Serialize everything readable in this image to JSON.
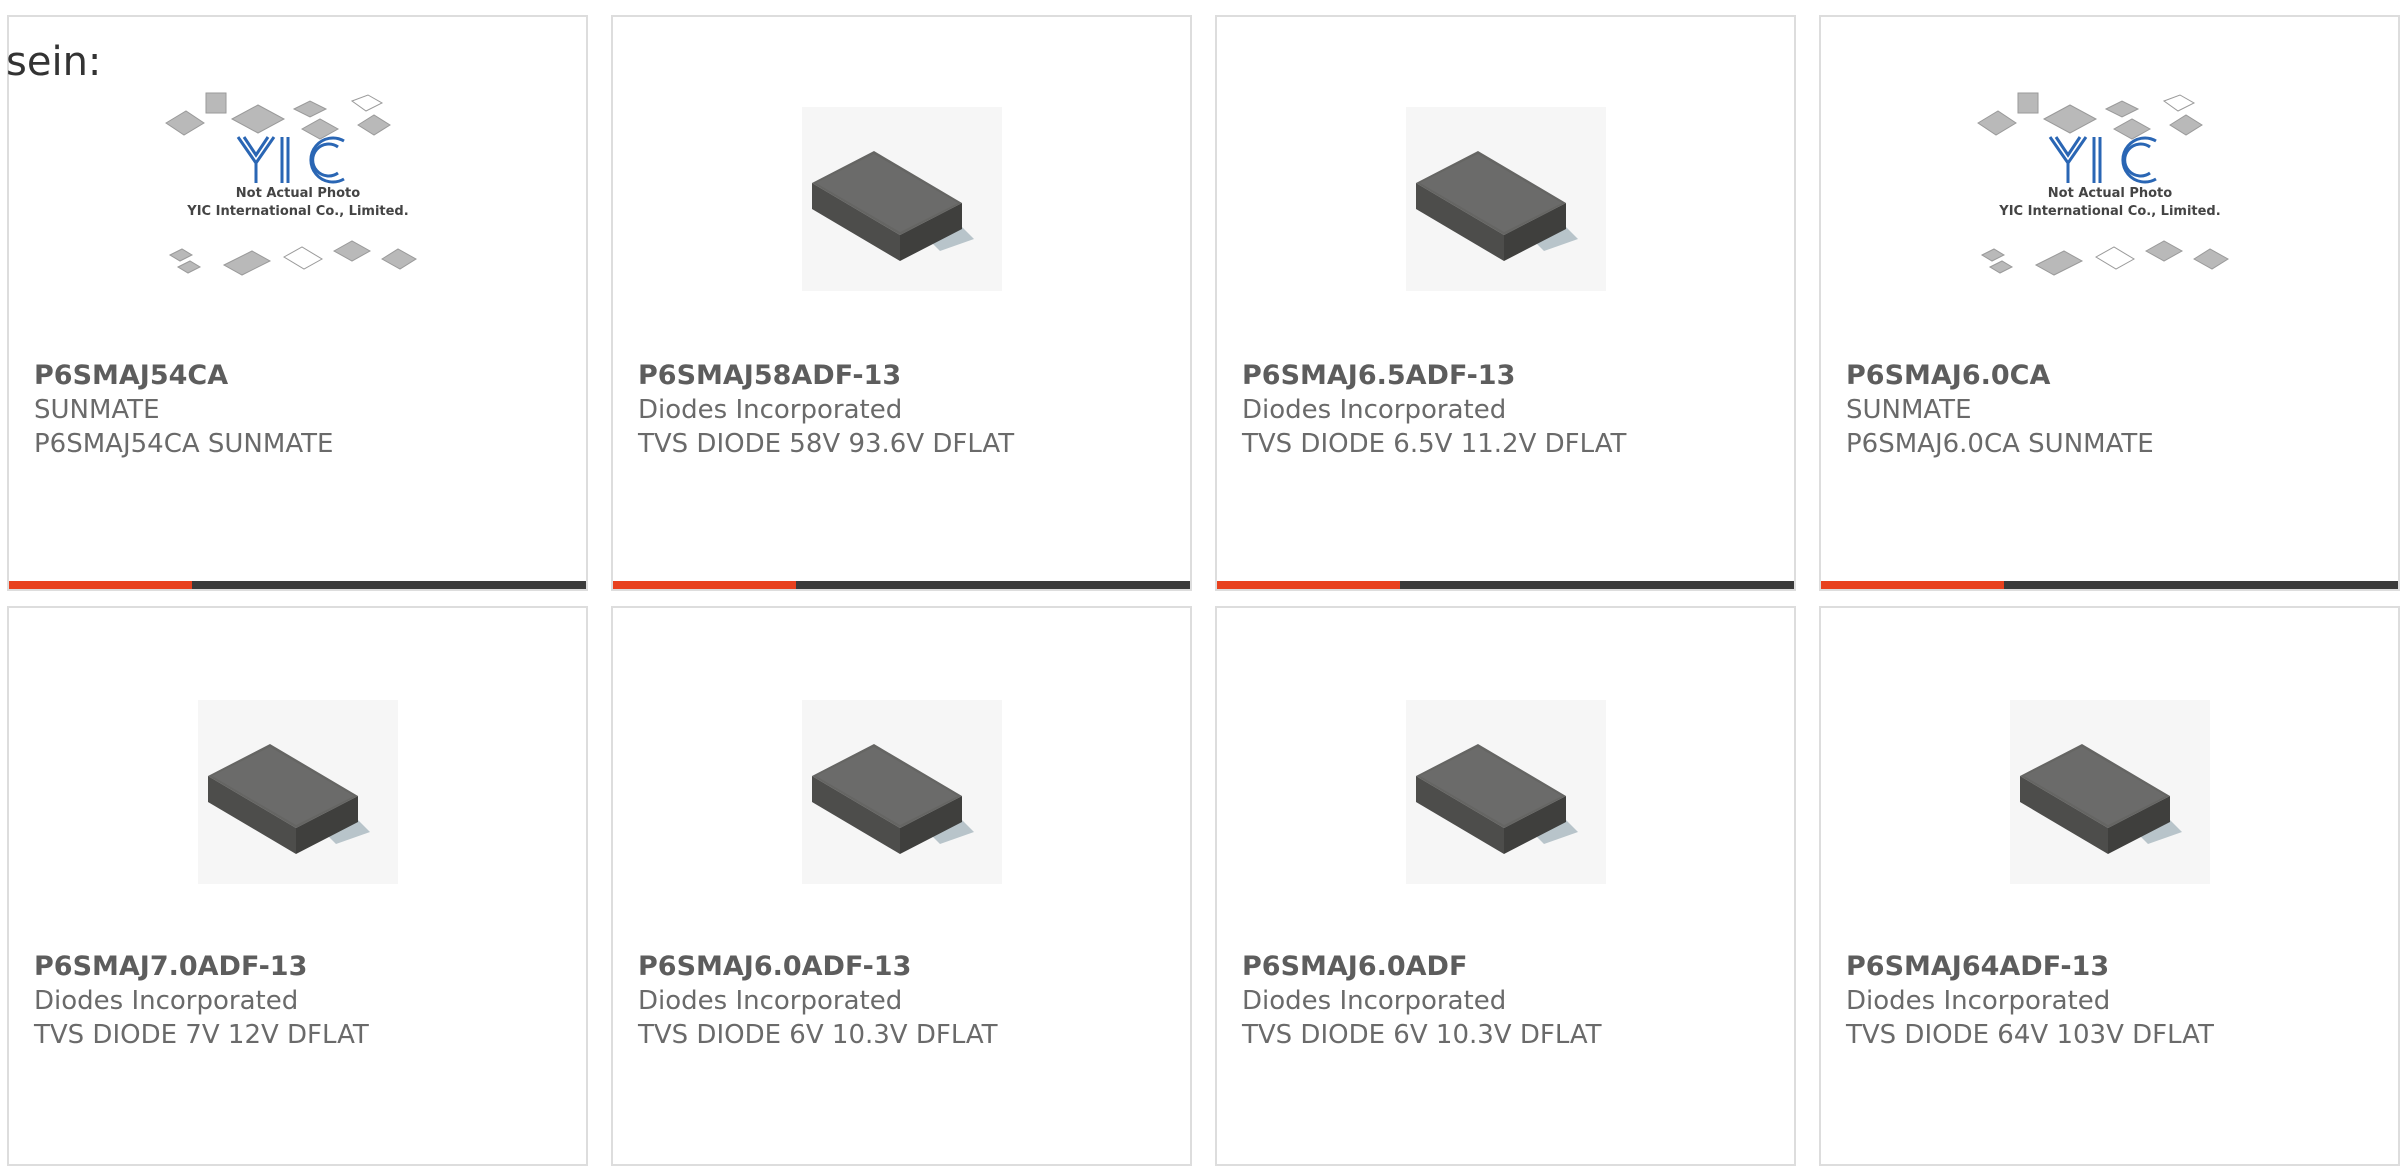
{
  "heading": "sein:",
  "colors": {
    "accent": "#e8411e",
    "bar": "#3a3a3a",
    "border": "#dddddd",
    "logo": "#2a66b4"
  },
  "placeholder": {
    "line1": "Not Actual Photo",
    "line2": "YIC International Co., Limited."
  },
  "products": [
    {
      "part": "P6SMAJ54CA",
      "manufacturer": "SUNMATE",
      "description": "P6SMAJ54CA SUNMATE",
      "image": "placeholder"
    },
    {
      "part": "P6SMAJ58ADF-13",
      "manufacturer": "Diodes Incorporated",
      "description": "TVS DIODE 58V 93.6V DFLAT",
      "image": "chip"
    },
    {
      "part": "P6SMAJ6.5ADF-13",
      "manufacturer": "Diodes Incorporated",
      "description": "TVS DIODE 6.5V 11.2V DFLAT",
      "image": "chip"
    },
    {
      "part": "P6SMAJ6.0CA",
      "manufacturer": "SUNMATE",
      "description": "P6SMAJ6.0CA SUNMATE",
      "image": "placeholder"
    },
    {
      "part": "P6SMAJ7.0ADF-13",
      "manufacturer": "Diodes Incorporated",
      "description": "TVS DIODE 7V 12V DFLAT",
      "image": "chip"
    },
    {
      "part": "P6SMAJ6.0ADF-13",
      "manufacturer": "Diodes Incorporated",
      "description": "TVS DIODE 6V 10.3V DFLAT",
      "image": "chip"
    },
    {
      "part": "P6SMAJ6.0ADF",
      "manufacturer": "Diodes Incorporated",
      "description": "TVS DIODE 6V 10.3V DFLAT",
      "image": "chip"
    },
    {
      "part": "P6SMAJ64ADF-13",
      "manufacturer": "Diodes Incorporated",
      "description": "TVS DIODE 64V 103V DFLAT",
      "image": "chip"
    }
  ]
}
